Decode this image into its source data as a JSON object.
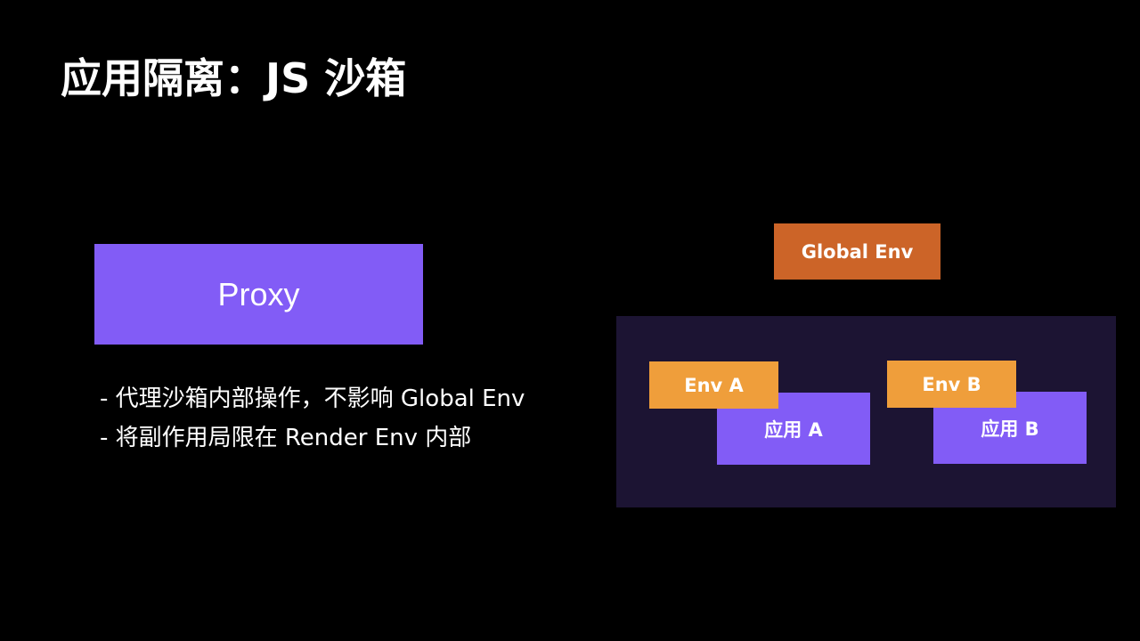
{
  "slide": {
    "title": "应用隔离：JS 沙箱"
  },
  "left": {
    "proxy_label": "Proxy",
    "bullets": [
      "- 代理沙箱内部操作，不影响 Global Env",
      "- 将副作用局限在 Render Env 内部"
    ]
  },
  "diagram": {
    "global_env": "Global Env",
    "env_a": "Env A",
    "env_b": "Env B",
    "app_a": "应用 A",
    "app_b": "应用 B"
  },
  "colors": {
    "background": "#000000",
    "purple": "#825cf6",
    "orange_dark": "#cc6428",
    "orange_light": "#ef9e3b",
    "render_env_bg": "#1c1433"
  }
}
